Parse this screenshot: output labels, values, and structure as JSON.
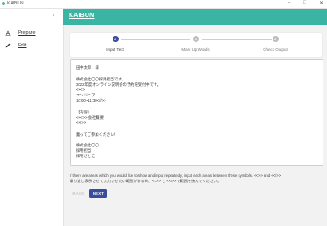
{
  "window": {
    "title": "KAIBUN"
  },
  "sidebar": {
    "collapse_icon": "chevron-left",
    "items": [
      {
        "label": "Prepare",
        "icon": "text-format-icon"
      },
      {
        "label": "Edit",
        "icon": "pencil-icon"
      }
    ]
  },
  "header": {
    "brand": "KAIBUN"
  },
  "stepper": {
    "steps": [
      {
        "number": "1",
        "label": "Input Text",
        "state": "active"
      },
      {
        "number": "2",
        "label": "Mark Up Words",
        "state": "inactive"
      },
      {
        "number": "3",
        "label": "Check Output",
        "state": "inactive"
      }
    ]
  },
  "editor": {
    "lines": [
      "田中太郎　様",
      "",
      "株式会社〇〇採用担当です。",
      "2022年度オンライン説明会の予約を受付中です。",
      "<<<>",
      "エンジニア",
      "10:00~11:30<//>>",
      "",
      "【内容】",
      "<<<>> 会社概要",
      "<</>>",
      "",
      "奮ってご参加ください！",
      "",
      "株式会社〇〇",
      "採用担当",
      "採用さとこ"
    ]
  },
  "instructions": {
    "line1": "If there are areas which you would like to show and input repeatedly, input each areas between these symbols. <<>> and <</>>",
    "line2": "繰り返し表示させて入力させたい範囲がある時、<<>> と <</>>で範囲を挟んでください。"
  },
  "buttons": {
    "back": "BACK",
    "next": "NEXT"
  },
  "colors": {
    "accent": "#3bb5a3",
    "primary": "#3a4d9c"
  }
}
